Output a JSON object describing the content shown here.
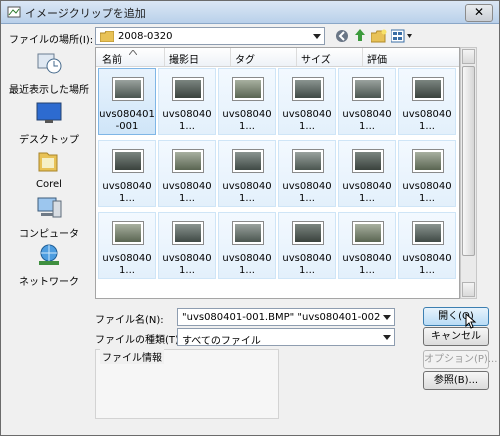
{
  "window": {
    "title": "イメージクリップを追加",
    "close_glyph": "✕"
  },
  "location": {
    "label": "ファイルの場所(I):",
    "folder": "2008-0320"
  },
  "columns": [
    "名前",
    "撮影日",
    "タグ",
    "サイズ",
    "評価"
  ],
  "sidebar": {
    "items": [
      {
        "label": "最近表示した場所",
        "icon": "recent-places-icon"
      },
      {
        "label": "デスクトップ",
        "icon": "desktop-icon"
      },
      {
        "label": "Corel",
        "icon": "folder-icon"
      },
      {
        "label": "コンピュータ",
        "icon": "computer-icon"
      },
      {
        "label": "ネットワーク",
        "icon": "network-icon"
      }
    ]
  },
  "files": [
    "uvs080401-001",
    "uvs080401...",
    "uvs080401...",
    "uvs080401...",
    "uvs080401...",
    "uvs080401...",
    "uvs080401...",
    "uvs080401...",
    "uvs080401...",
    "uvs080401...",
    "uvs080401...",
    "uvs080401...",
    "uvs080401...",
    "uvs080401...",
    "uvs080401...",
    "uvs080401...",
    "uvs080401...",
    "uvs080401..."
  ],
  "filename": {
    "label": "ファイル名(N):",
    "value": "\"uvs080401-001.BMP\" \"uvs080401-002.BMP\" \"uvs"
  },
  "filetype": {
    "label": "ファイルの種類(T):",
    "value": "すべてのファイル"
  },
  "fileinfo": {
    "label": "ファイル情報"
  },
  "buttons": {
    "open": "開く(O)",
    "cancel": "キャンセル",
    "options": "オプション(P)...",
    "browse": "参照(B)..."
  },
  "colors": {
    "accent": "#3c7fb1",
    "selection": "#cfe5f8"
  }
}
